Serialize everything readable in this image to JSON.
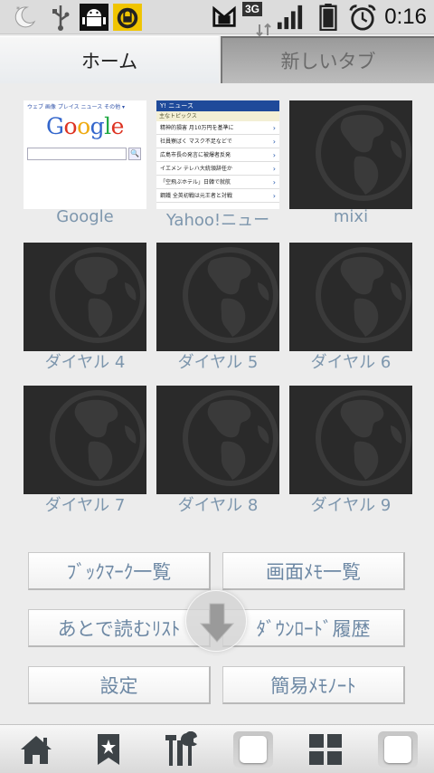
{
  "status_bar": {
    "network": "3G",
    "time": "0:16"
  },
  "tabs": {
    "home": "ホーム",
    "new_tab": "新しいタブ"
  },
  "dials": [
    {
      "label": "Google",
      "thumb": "google"
    },
    {
      "label": "Yahoo!ニュー",
      "thumb": "yahoo"
    },
    {
      "label": "mixi",
      "thumb": "globe"
    },
    {
      "label": "ダイヤル 4",
      "thumb": "globe"
    },
    {
      "label": "ダイヤル 5",
      "thumb": "globe"
    },
    {
      "label": "ダイヤル 6",
      "thumb": "globe"
    },
    {
      "label": "ダイヤル 7",
      "thumb": "globe"
    },
    {
      "label": "ダイヤル 8",
      "thumb": "globe"
    },
    {
      "label": "ダイヤル 9",
      "thumb": "globe"
    }
  ],
  "google_thumb": {
    "nav": "ウェブ  画像  プレイス  ニュース  その他 ▾",
    "logo_letters": [
      "G",
      "o",
      "o",
      "g",
      "l",
      "e"
    ],
    "logo_colors": [
      "#3366cc",
      "#dd3322",
      "#eeaa11",
      "#3366cc",
      "#22aa44",
      "#dd3322"
    ],
    "search_btn": "🔍"
  },
  "yahoo_thumb": {
    "header": "Y! ニュース",
    "subheader": "主なトピックス",
    "rows": [
      "精神的損害 月10万円を基準に",
      "社員寮ばく マスク不足などで",
      "広島市長の発言に被爆者反発",
      "イエメン テレハ大統領辞任か",
      "「空飛ぶホテル」日韓で就航",
      "鋼鐵 全英初戦は元王者と対戦"
    ],
    "arrow": "›"
  },
  "buttons": {
    "bookmarks": "ﾌﾞｯｸﾏｰｸ一覧",
    "memo_list": "画面ﾒﾓ一覧",
    "read_later": "あとで読むﾘｽﾄ",
    "downloads": "ﾀﾞｳﾝﾛｰﾄﾞ履歴",
    "settings": "設定",
    "easy_memo": "簡易ﾒﾓﾉｰﾄ"
  },
  "colors": {
    "label_blue": "#7d96ad",
    "button_text": "#6d88a4",
    "dial_bg": "#2a2a2a",
    "globe": "#3a3a3a"
  },
  "icons": {
    "moon": "moon-icon",
    "usb": "usb-icon",
    "android": "android-debug-icon",
    "lock": "lock-app-icon",
    "sim": "sim-icon",
    "signal": "signal-icon",
    "battery": "battery-icon",
    "alarm": "alarm-icon",
    "home": "home-icon",
    "bookmark": "bookmark-icon",
    "tools": "tools-icon",
    "window": "window-icon",
    "grid": "grid-icon",
    "overflow": "window-alt-icon"
  }
}
